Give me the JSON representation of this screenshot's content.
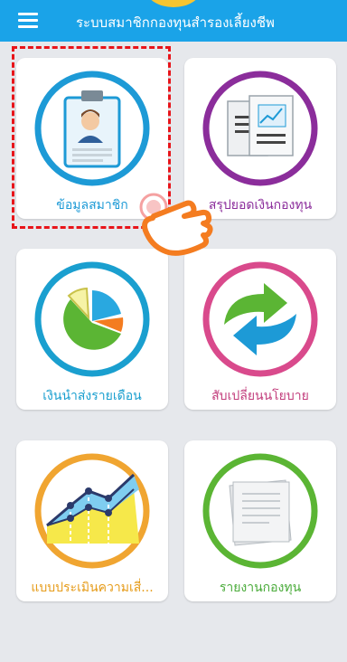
{
  "header": {
    "title": "ระบบสมาชิกกองทุนสำรองเลี้ยงชีพ",
    "menu_icon": "hamburger-icon"
  },
  "menu": [
    {
      "label": "ข้อมูลสมาชิก",
      "icon": "id-badge-icon",
      "color": "#1d9ad6"
    },
    {
      "label": "สรุปยอดเงินกองทุน",
      "icon": "report-document-icon",
      "color": "#8b2d9b"
    },
    {
      "label": "เงินนำส่งรายเดือน",
      "icon": "pie-chart-icon",
      "color": "#1a9fcf"
    },
    {
      "label": "สับเปลี่ยนนโยบาย",
      "icon": "swap-arrows-icon",
      "color": "#c23d7c"
    },
    {
      "label": "แบบประเมินความเสี่...",
      "icon": "risk-chart-icon",
      "color": "#e69c1a"
    },
    {
      "label": "รายงานกองทุน",
      "icon": "paper-stack-icon",
      "color": "#4aab3a"
    }
  ],
  "colors": {
    "header_bg": "#1aa3e8",
    "highlight": "#e8141a",
    "hand": "#f47c20"
  }
}
